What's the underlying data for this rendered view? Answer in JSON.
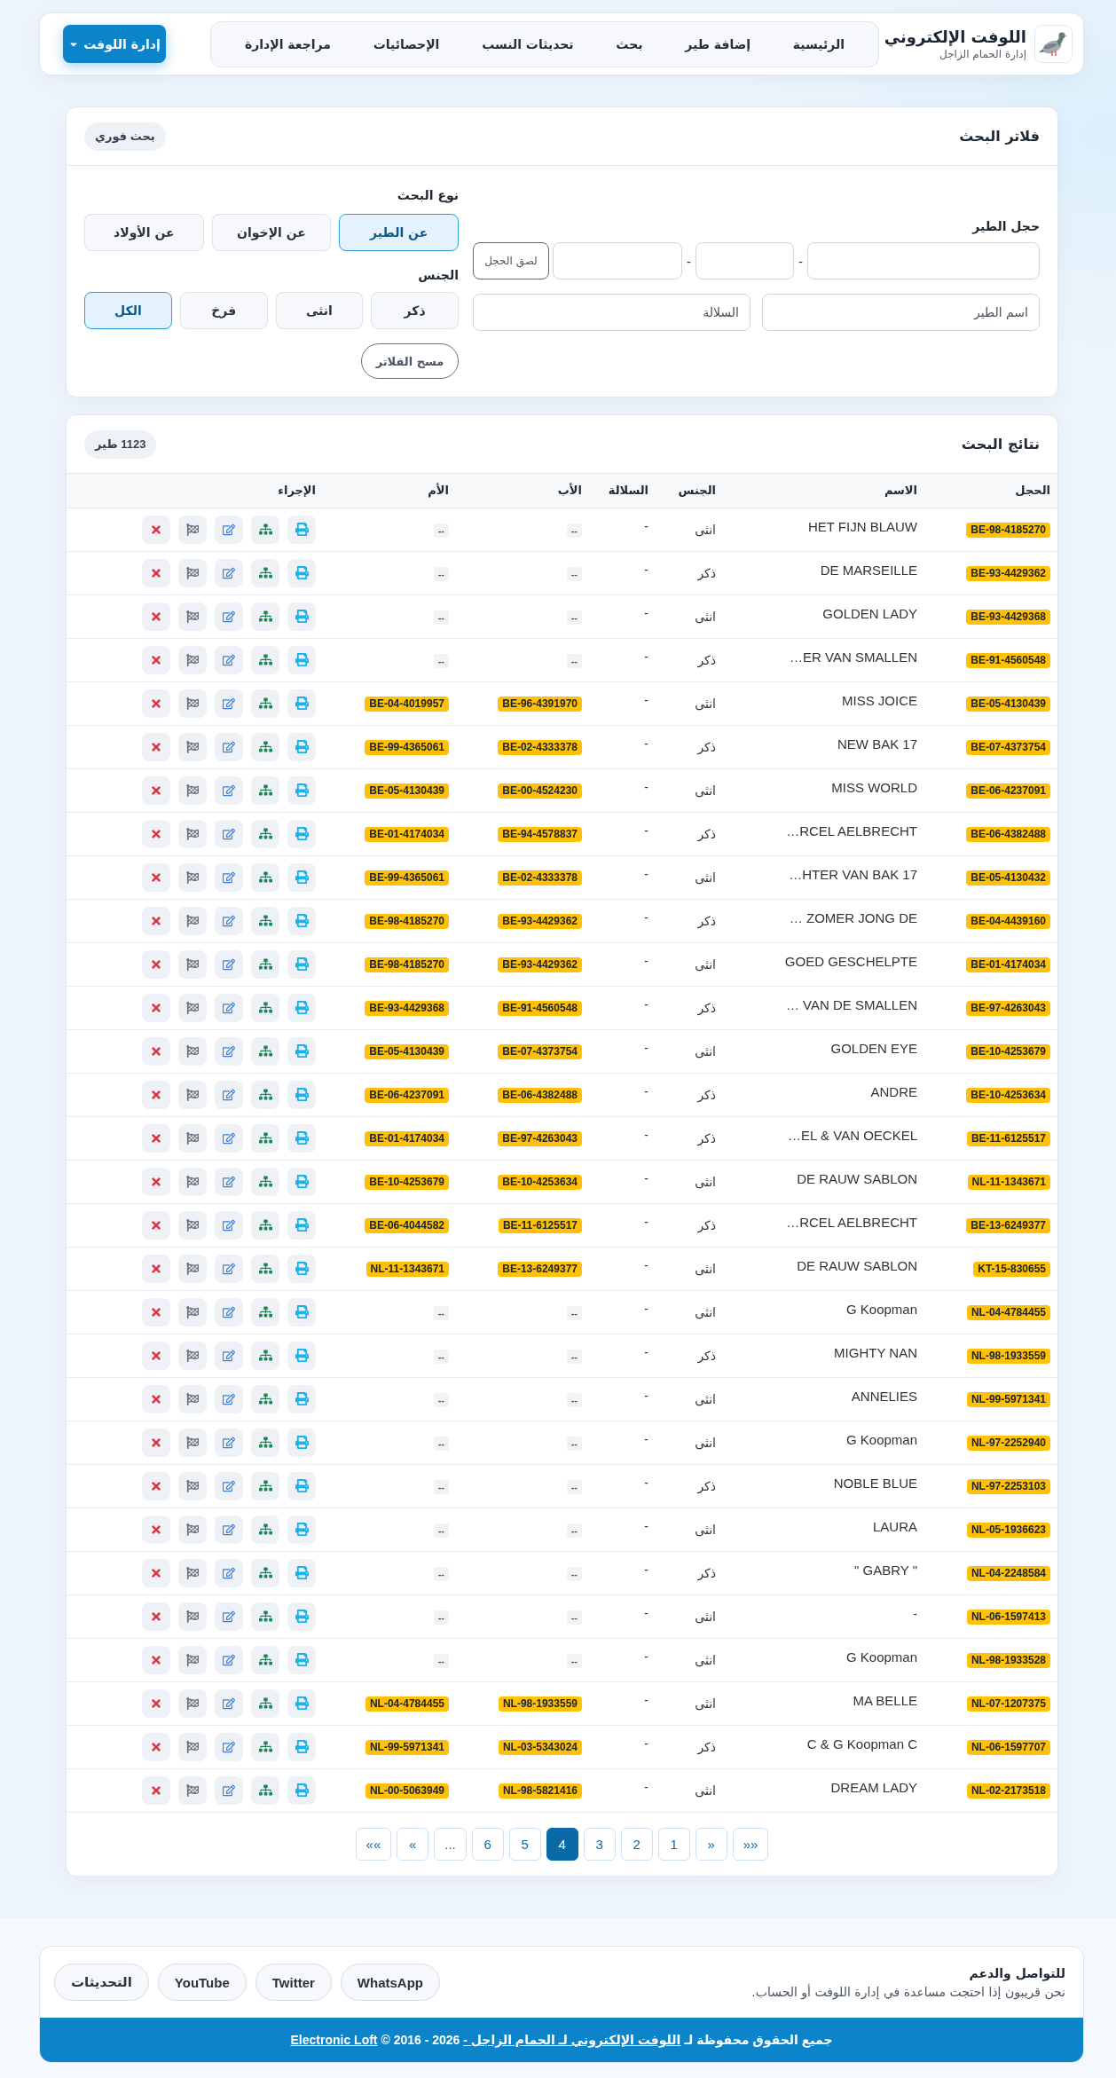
{
  "header": {
    "title": "اللوفت الإلكتروني",
    "subtitle": "إدارة الحمام الزاجل",
    "nav": [
      "الرئيسية",
      "إضافة طير",
      "بحث",
      "تحديثات النسب",
      "الإحصائيات",
      "مراجعة الإدارة"
    ],
    "menu_button": "إدارة اللوفت"
  },
  "filters": {
    "title": "فلاتر البحث",
    "badge": "بحث فوري",
    "ring": {
      "label": "حجل الطير",
      "fields": [
        {
          "kind": "input"
        },
        {
          "kind": "separator",
          "text": "-"
        },
        {
          "kind": "input"
        },
        {
          "kind": "separator",
          "text": "-"
        },
        {
          "kind": "input"
        },
        {
          "kind": "button",
          "label": "لصق الحجل"
        }
      ]
    },
    "name_field": {
      "placeholder": "اسم الطير"
    },
    "race_field": {
      "placeholder": "السلالة"
    },
    "search_type": {
      "label": "نوع البحث",
      "options": [
        {
          "label": "عن الطير",
          "selected": true
        },
        {
          "label": "عن الإخوان",
          "selected": false
        },
        {
          "label": "عن الأولاد",
          "selected": false
        }
      ]
    },
    "sex": {
      "label": "الجنس",
      "options": [
        {
          "label": "ذكر",
          "selected": false
        },
        {
          "label": "انثى",
          "selected": false
        },
        {
          "label": "فرخ",
          "selected": false
        },
        {
          "label": "الكل",
          "selected": true
        }
      ]
    },
    "clear_button": "مسح الفلاتر"
  },
  "results": {
    "title": "نتائج البحث",
    "count": "1123 طير",
    "columns": [
      "الحجل",
      "الاسم",
      "الجنس",
      "السلالة",
      "الأب",
      "الأم",
      "الإجراء"
    ],
    "rows": [
      {
        "ring": "BE-98-4185270",
        "name": "HET FIJN BLAUW",
        "sex": "انثى",
        "race": "-",
        "father": {
          "kind": "none",
          "text": "--"
        },
        "mother": {
          "kind": "none",
          "text": "--"
        }
      },
      {
        "ring": "BE-93-4429362",
        "name": "DE MARSEILLE",
        "sex": "ذكر",
        "race": "-",
        "father": {
          "kind": "none",
          "text": "--"
        },
        "mother": {
          "kind": "none",
          "text": "--"
        }
      },
      {
        "ring": "BE-93-4429368",
        "name": "GOLDEN LADY",
        "sex": "انثى",
        "race": "-",
        "father": {
          "kind": "none",
          "text": "--"
        },
        "mother": {
          "kind": "none",
          "text": "--"
        }
      },
      {
        "ring": "BE-91-4560548",
        "name": "…ER VAN SMALLEN",
        "sex": "ذكر",
        "race": "-",
        "father": {
          "kind": "none",
          "text": "--"
        },
        "mother": {
          "kind": "none",
          "text": "--"
        }
      },
      {
        "ring": "BE-05-4130439",
        "name": "MISS JOICE",
        "sex": "انثى",
        "race": "-",
        "father": {
          "kind": "ring",
          "text": "BE-96-4391970"
        },
        "mother": {
          "kind": "ring",
          "text": "BE-04-4019957"
        }
      },
      {
        "ring": "BE-07-4373754",
        "name": "NEW BAK 17",
        "sex": "ذكر",
        "race": "-",
        "father": {
          "kind": "ring",
          "text": "BE-02-4333378"
        },
        "mother": {
          "kind": "ring",
          "text": "BE-99-4365061"
        }
      },
      {
        "ring": "BE-06-4237091",
        "name": "MISS WORLD",
        "sex": "انثى",
        "race": "-",
        "father": {
          "kind": "ring",
          "text": "BE-00-4524230"
        },
        "mother": {
          "kind": "ring",
          "text": "BE-05-4130439"
        }
      },
      {
        "ring": "BE-06-4382488",
        "name": "…RCEL AELBRECHT",
        "sex": "ذكر",
        "race": "-",
        "father": {
          "kind": "ring",
          "text": "BE-94-4578837"
        },
        "mother": {
          "kind": "ring",
          "text": "BE-01-4174034"
        }
      },
      {
        "ring": "BE-05-4130432",
        "name": "…HTER VAN BAK 17",
        "sex": "انثى",
        "race": "-",
        "father": {
          "kind": "ring",
          "text": "BE-02-4333378"
        },
        "mother": {
          "kind": "ring",
          "text": "BE-99-4365061"
        }
      },
      {
        "ring": "BE-04-4439160",
        "name": "… ZOMER JONG DE",
        "sex": "ذكر",
        "race": "-",
        "father": {
          "kind": "ring",
          "text": "BE-93-4429362"
        },
        "mother": {
          "kind": "ring",
          "text": "BE-98-4185270"
        }
      },
      {
        "ring": "BE-01-4174034",
        "name": "GOED GESCHELPTE",
        "sex": "انثى",
        "race": "-",
        "father": {
          "kind": "ring",
          "text": "BE-93-4429362"
        },
        "mother": {
          "kind": "ring",
          "text": "BE-98-4185270"
        }
      },
      {
        "ring": "BE-97-4263043",
        "name": "… VAN DE SMALLEN",
        "sex": "ذكر",
        "race": "-",
        "father": {
          "kind": "ring",
          "text": "BE-91-4560548"
        },
        "mother": {
          "kind": "ring",
          "text": "BE-93-4429368"
        }
      },
      {
        "ring": "BE-10-4253679",
        "name": "GOLDEN EYE",
        "sex": "انثى",
        "race": "-",
        "father": {
          "kind": "ring",
          "text": "BE-07-4373754"
        },
        "mother": {
          "kind": "ring",
          "text": "BE-05-4130439"
        }
      },
      {
        "ring": "BE-10-4253634",
        "name": "ANDRE",
        "sex": "ذكر",
        "race": "-",
        "father": {
          "kind": "ring",
          "text": "BE-06-4382488"
        },
        "mother": {
          "kind": "ring",
          "text": "BE-06-4237091"
        }
      },
      {
        "ring": "BE-11-6125517",
        "name": "…EL & VAN OECKEL",
        "sex": "ذكر",
        "race": "-",
        "father": {
          "kind": "ring",
          "text": "BE-97-4263043"
        },
        "mother": {
          "kind": "ring",
          "text": "BE-01-4174034"
        }
      },
      {
        "ring": "NL-11-1343671",
        "name": "DE RAUW SABLON",
        "sex": "انثى",
        "race": "-",
        "father": {
          "kind": "ring",
          "text": "BE-10-4253634"
        },
        "mother": {
          "kind": "ring",
          "text": "BE-10-4253679"
        }
      },
      {
        "ring": "BE-13-6249377",
        "name": "…RCEL AELBRECHT",
        "sex": "ذكر",
        "race": "-",
        "father": {
          "kind": "ring",
          "text": "BE-11-6125517"
        },
        "mother": {
          "kind": "ring",
          "text": "BE-06-4044582"
        }
      },
      {
        "ring": "KT-15-830655",
        "name": "DE RAUW SABLON",
        "sex": "انثى",
        "race": "-",
        "father": {
          "kind": "ring",
          "text": "BE-13-6249377"
        },
        "mother": {
          "kind": "ring",
          "text": "NL-11-1343671"
        }
      },
      {
        "ring": "NL-04-4784455",
        "name": "G Koopman",
        "sex": "انثى",
        "race": "-",
        "father": {
          "kind": "none",
          "text": "--"
        },
        "mother": {
          "kind": "none",
          "text": "--"
        }
      },
      {
        "ring": "NL-98-1933559",
        "name": "MIGHTY NAN",
        "sex": "ذكر",
        "race": "-",
        "father": {
          "kind": "none",
          "text": "--"
        },
        "mother": {
          "kind": "none",
          "text": "--"
        }
      },
      {
        "ring": "NL-99-5971341",
        "name": "ANNELIES",
        "sex": "انثى",
        "race": "-",
        "father": {
          "kind": "none",
          "text": "--"
        },
        "mother": {
          "kind": "none",
          "text": "--"
        }
      },
      {
        "ring": "NL-97-2252940",
        "name": "G Koopman",
        "sex": "انثى",
        "race": "-",
        "father": {
          "kind": "none",
          "text": "--"
        },
        "mother": {
          "kind": "none",
          "text": "--"
        }
      },
      {
        "ring": "NL-97-2253103",
        "name": "NOBLE BLUE",
        "sex": "ذكر",
        "race": "-",
        "father": {
          "kind": "none",
          "text": "--"
        },
        "mother": {
          "kind": "none",
          "text": "--"
        }
      },
      {
        "ring": "NL-05-1936623",
        "name": "LAURA",
        "sex": "انثى",
        "race": "-",
        "father": {
          "kind": "none",
          "text": "--"
        },
        "mother": {
          "kind": "none",
          "text": "--"
        }
      },
      {
        "ring": "NL-04-2248584",
        "name": "\" GABRY \"",
        "sex": "ذكر",
        "race": "-",
        "father": {
          "kind": "none",
          "text": "--"
        },
        "mother": {
          "kind": "none",
          "text": "--"
        }
      },
      {
        "ring": "NL-06-1597413",
        "name": "-",
        "sex": "انثى",
        "race": "-",
        "father": {
          "kind": "none",
          "text": "--"
        },
        "mother": {
          "kind": "none",
          "text": "--"
        }
      },
      {
        "ring": "NL-98-1933528",
        "name": "G Koopman",
        "sex": "انثى",
        "race": "-",
        "father": {
          "kind": "none",
          "text": "--"
        },
        "mother": {
          "kind": "none",
          "text": "--"
        }
      },
      {
        "ring": "NL-07-1207375",
        "name": "MA BELLE",
        "sex": "انثى",
        "race": "-",
        "father": {
          "kind": "ring",
          "text": "NL-98-1933559"
        },
        "mother": {
          "kind": "ring",
          "text": "NL-04-4784455"
        }
      },
      {
        "ring": "NL-06-1597707",
        "name": "C & G Koopman C",
        "sex": "ذكر",
        "race": "-",
        "father": {
          "kind": "ring",
          "text": "NL-03-5343024"
        },
        "mother": {
          "kind": "ring",
          "text": "NL-99-5971341"
        }
      },
      {
        "ring": "NL-02-2173518",
        "name": "DREAM LADY",
        "sex": "انثى",
        "race": "-",
        "father": {
          "kind": "ring",
          "text": "NL-98-5821416"
        },
        "mother": {
          "kind": "ring",
          "text": "NL-00-5063949"
        }
      }
    ],
    "pagination": [
      {
        "label": "»»",
        "selected": false
      },
      {
        "label": "»",
        "selected": false
      },
      {
        "label": "1",
        "selected": false
      },
      {
        "label": "2",
        "selected": false
      },
      {
        "label": "3",
        "selected": false
      },
      {
        "label": "4",
        "selected": true
      },
      {
        "label": "5",
        "selected": false
      },
      {
        "label": "6",
        "selected": false
      },
      {
        "label": "...",
        "selected": false
      },
      {
        "label": "«",
        "selected": false
      },
      {
        "label": "««",
        "selected": false
      }
    ]
  },
  "footer": {
    "contact_title": "للتواصل والدعم",
    "contact_text": "نحن قريبون إذا احتجت مساعدة في إدارة اللوفت أو الحساب.",
    "links": [
      "WhatsApp",
      "Twitter",
      "YouTube",
      "التحديثات"
    ],
    "copyright": {
      "prefix": "جميع الحقوق محفوظة لـ",
      "site_link": "اللوفت الإلكتروني لـ الحمام الزاجل -",
      "years": "2026 - 2016 ©",
      "brand_link": "Electronic Loft"
    }
  }
}
